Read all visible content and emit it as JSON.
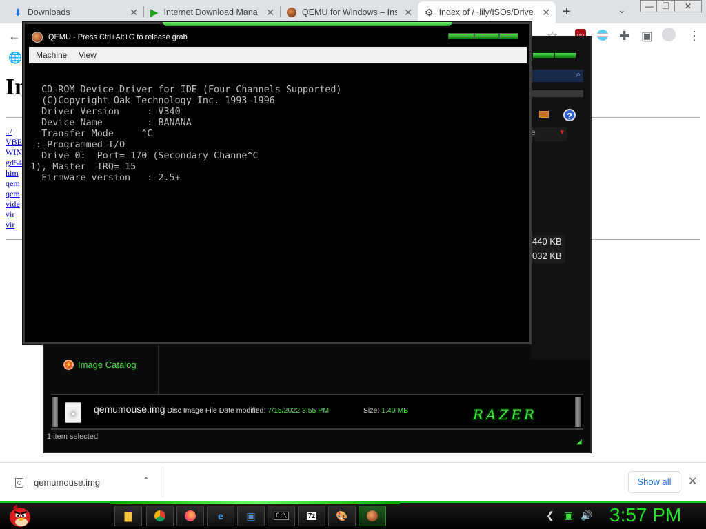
{
  "browser": {
    "tabs": [
      {
        "title": "Downloads",
        "icon": "download-icon"
      },
      {
        "title": "Internet Download Mana",
        "icon": "idm-play-icon"
      },
      {
        "title": "QEMU for Windows – Ins",
        "icon": "qemu-icon"
      },
      {
        "title": "Index of /~lily/ISOs/Drive",
        "icon": "apache-index-icon",
        "active": true
      }
    ]
  },
  "page": {
    "heading": "In",
    "links": [
      "../",
      "VBEM",
      "WINN",
      "gd54",
      "him",
      "qem",
      "qem",
      "vide",
      "vir",
      "vir"
    ]
  },
  "explorer": {
    "sizes": [
      "440 KB",
      "032 KB"
    ],
    "combo_text": "e",
    "catalog_label": "Image Catalog",
    "details": {
      "filename": "qemumouse.img",
      "type": "Disc Image File",
      "date_label": "Date modified:",
      "date_value": "7/15/2022 3:55 PM",
      "size_label": "Size:",
      "size_value": "1.40 MB"
    },
    "brand": "RAZER",
    "status": "1 item selected"
  },
  "qemu": {
    "title": "QEMU - Press Ctrl+Alt+G to release grab",
    "menu": [
      "Machine",
      "View"
    ],
    "console_lines": [
      "  CD-ROM Device Driver for IDE (Four Channels Supported)",
      "  (C)Copyright Oak Technology Inc. 1993-1996",
      "  Driver Version     : V340",
      "  Device Name        : BANANA",
      "  Transfer Mode     ^C",
      " : Programmed I/O",
      "  Drive 0:  Port= 170 (Secondary Channe^C",
      "1), Master  IRQ= 15",
      "  Firmware version   : 2.5+"
    ]
  },
  "downloads": {
    "filename": "qemumouse.img",
    "show_all": "Show all"
  },
  "taskbar": {
    "clock": "3:57 PM"
  },
  "colors": {
    "razer_green": "#3fe33f",
    "link_blue": "#0000ee",
    "chrome_blue": "#1a73e8"
  }
}
